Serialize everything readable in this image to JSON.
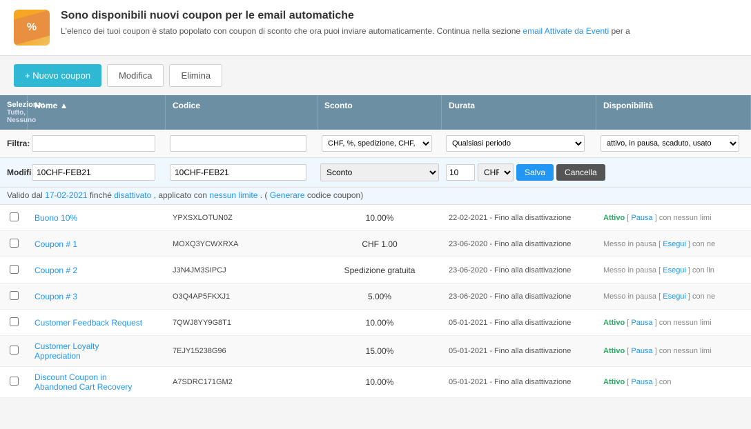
{
  "banner": {
    "title": "Sono disponibili nuovi coupon per le email automatiche",
    "description": "L'elenco dei tuoi coupon è stato popolato con coupon di sconto che ora puoi inviare automaticamente. Continua nella sezione",
    "link_text": "email Attivate da Eventi",
    "link_suffix": " per a"
  },
  "toolbar": {
    "new_coupon": "+ Nuovo coupon",
    "modifica": "Modifica",
    "elimina": "Elimina"
  },
  "table": {
    "select_label": "Seleziona:",
    "select_options": "Tutto, Nessuno",
    "columns": [
      "Nome ▲",
      "Codice",
      "Sconto",
      "Durata",
      "Disponibilità"
    ],
    "filter_label": "Filtra:",
    "filter_name_placeholder": "",
    "filter_code_placeholder": "",
    "filter_sconto_options": "CHF, %, spedizione, CHF,",
    "filter_durata_options": "Qualsiasi periodo",
    "filter_disponibilita_options": "attivo, in pausa, scaduto, usato",
    "edit_label": "Modifica:",
    "edit_name_value": "10CHF-FEB21",
    "edit_code_value": "10CHF-FEB21",
    "edit_sconto_options": "Sconto",
    "edit_amount": "10",
    "edit_currency": "CHF",
    "edit_save": "Salva",
    "edit_cancel": "Cancella",
    "valid_text": "Valido dal",
    "valid_date": "17-02-2021",
    "valid_middle": "finché",
    "valid_link1": "disattivato",
    "valid_text2": ", applicato con",
    "valid_link2": "nessun limite",
    "valid_text3": ". (",
    "valid_link3": "Generare",
    "valid_text4": " codice coupon)"
  },
  "rows": [
    {
      "name": "Buono 10%",
      "code": "YPXSXLOTUN0Z",
      "sconto": "10.00%",
      "durata": "22-02-2021 - Fino alla disattivazione",
      "disponibilita": "Attivo",
      "disponibilita_extra": "[ Pausa ] con nessun limi"
    },
    {
      "name": "Coupon # 1",
      "code": "MOXQ3YCWXRXA",
      "sconto": "CHF 1.00",
      "durata": "23-06-2020 - Fino alla disattivazione",
      "disponibilita": "Messo in pausa",
      "disponibilita_extra": "[ Esegui ] con ne"
    },
    {
      "name": "Coupon # 2",
      "code": "J3N4JM3SIPCJ",
      "sconto": "Spedizione gratuita",
      "durata": "23-06-2020 - Fino alla disattivazione",
      "disponibilita": "Messo in pausa",
      "disponibilita_extra": "[ Esegui ] con lin"
    },
    {
      "name": "Coupon # 3",
      "code": "O3Q4AP5FKXJ1",
      "sconto": "5.00%",
      "durata": "23-06-2020 - Fino alla disattivazione",
      "disponibilita": "Messo in pausa",
      "disponibilita_extra": "[ Esegui ] con ne"
    },
    {
      "name": "Customer Feedback Request",
      "code": "7QWJ8YY9G8T1",
      "sconto": "10.00%",
      "durata": "05-01-2021 - Fino alla disattivazione",
      "disponibilita": "Attivo",
      "disponibilita_extra": "[ Pausa ] con nessun limi"
    },
    {
      "name": "Customer Loyalty Appreciation",
      "name_line2": "Appreciation",
      "code": "7EJY15238G96",
      "sconto": "15.00%",
      "durata": "05-01-2021 - Fino alla disattivazione",
      "disponibilita": "Attivo",
      "disponibilita_extra": "[ Pausa ] con nessun limi"
    },
    {
      "name": "Discount Coupon in Abandoned Cart Recovery",
      "name_line2": "Abandoned Cart Recovery",
      "code": "A7SDRC171GM2",
      "sconto": "10.00%",
      "durata": "05-01-2021 - Fino alla disattivazione",
      "disponibilita": "Attivo",
      "disponibilita_extra": "[ Pausa ] con"
    }
  ],
  "colors": {
    "header_bg": "#6c8fa3",
    "attivo": "#27ae60",
    "pausa": "#888888",
    "link": "#2196f3",
    "primary_btn": "#2eb8d4"
  }
}
